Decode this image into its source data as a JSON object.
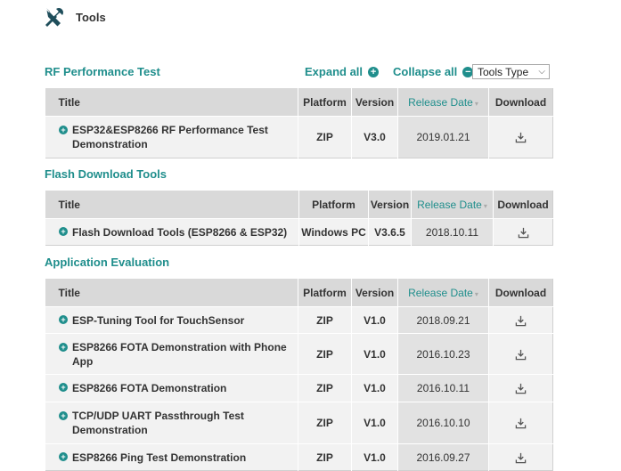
{
  "header": {
    "title": "Tools",
    "icon": "tools-icon"
  },
  "controls": {
    "expand_all": "Expand all",
    "collapse_all": "Collapse all",
    "tools_type": "Tools Type"
  },
  "columns": {
    "title": "Title",
    "platform": "Platform",
    "version": "Version",
    "release_date": "Release Date",
    "download": "Download"
  },
  "sections": [
    {
      "name": "RF Performance Test",
      "rows": [
        {
          "title": "ESP32&ESP8266 RF Performance Test Demonstration",
          "platform": "ZIP",
          "version": "V3.0",
          "date": "2019.01.21"
        }
      ]
    },
    {
      "name": "Flash Download Tools",
      "rows": [
        {
          "title": "Flash Download Tools (ESP8266 & ESP32)",
          "platform": "Windows PC",
          "version": "V3.6.5",
          "date": "2018.10.11"
        }
      ]
    },
    {
      "name": "Application Evaluation",
      "rows": [
        {
          "title": "ESP-Tuning Tool for TouchSensor",
          "platform": "ZIP",
          "version": "V1.0",
          "date": "2018.09.21"
        },
        {
          "title": "ESP8266 FOTA Demonstration with Phone App",
          "platform": "ZIP",
          "version": "V1.0",
          "date": "2016.10.23"
        },
        {
          "title": "ESP8266 FOTA Demonstration",
          "platform": "ZIP",
          "version": "V1.0",
          "date": "2016.10.11"
        },
        {
          "title": "TCP/UDP UART Passthrough Test Demonstration",
          "platform": "ZIP",
          "version": "V1.0",
          "date": "2016.10.10"
        },
        {
          "title": "ESP8266 Ping Test Demonstration",
          "platform": "ZIP",
          "version": "V1.0",
          "date": "2016.09.27"
        }
      ]
    }
  ],
  "colors": {
    "accent": "#1f8e8c",
    "header_bg": "#d9d9d9",
    "row_bg": "#f2f2f2"
  }
}
